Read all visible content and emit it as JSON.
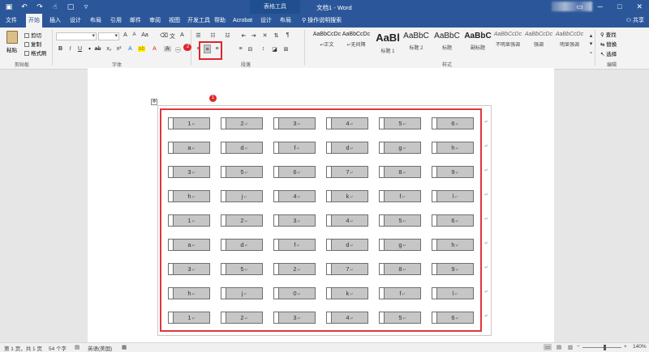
{
  "titlebar": {
    "context_tab": "表格工具",
    "doc_title": "文档1 - Word"
  },
  "tabs": [
    {
      "label": "文件",
      "active": false
    },
    {
      "label": "开始",
      "active": true
    },
    {
      "label": "插入",
      "active": false
    },
    {
      "label": "设计",
      "active": false
    },
    {
      "label": "布局",
      "active": false
    },
    {
      "label": "引用",
      "active": false
    },
    {
      "label": "邮件",
      "active": false
    },
    {
      "label": "审阅",
      "active": false
    },
    {
      "label": "视图",
      "active": false
    },
    {
      "label": "开发工具",
      "active": false
    },
    {
      "label": "帮助",
      "active": false
    },
    {
      "label": "Acrobat",
      "active": false
    },
    {
      "label": "设计",
      "active": false
    },
    {
      "label": "布局",
      "active": false
    }
  ],
  "tell_me": "操作说明搜索",
  "share": "共享",
  "clipboard": {
    "paste": "粘贴",
    "cut": "剪切",
    "copy": "复制",
    "format_painter": "格式刷",
    "group": "剪贴板"
  },
  "font": {
    "group": "字体"
  },
  "paragraph": {
    "group": "段落"
  },
  "badges": {
    "one": "1",
    "two": "2"
  },
  "styles": {
    "group": "样式",
    "items": [
      {
        "preview": "AaBbCcDc",
        "name": "↵正文"
      },
      {
        "preview": "AaBbCcDc",
        "name": "↵无间隔"
      },
      {
        "preview": "AaBl",
        "name": "标题 1"
      },
      {
        "preview": "AaBbC",
        "name": "标题 2"
      },
      {
        "preview": "AaBbC",
        "name": "标题"
      },
      {
        "preview": "AaBbC",
        "name": "副标题"
      },
      {
        "preview": "AaBbCcDc",
        "name": "不明显强调"
      },
      {
        "preview": "AaBbCcDc",
        "name": "强调"
      },
      {
        "preview": "AaBbCcDc",
        "name": "明显强调"
      }
    ]
  },
  "editing": {
    "find": "查找",
    "replace": "替换",
    "select": "选择",
    "group": "编辑"
  },
  "table": {
    "rows": [
      [
        "1",
        "2",
        "3",
        "4",
        "5",
        "6"
      ],
      [
        "a",
        "d",
        "f",
        "d",
        "g",
        "h"
      ],
      [
        "3",
        "5",
        "6",
        "7",
        "8",
        "9"
      ],
      [
        "h",
        "j",
        "4",
        "k",
        "f",
        "l"
      ],
      [
        "1",
        "2",
        "3",
        "4",
        "5",
        "6"
      ],
      [
        "a",
        "d",
        "f",
        "d",
        "g",
        "h"
      ],
      [
        "3",
        "5",
        "2",
        "7",
        "8",
        "9"
      ],
      [
        "h",
        "j",
        "0",
        "k",
        "f",
        "l"
      ],
      [
        "1",
        "2",
        "3",
        "4",
        "5",
        "6"
      ]
    ]
  },
  "status": {
    "page": "第 1 页，共 1 页",
    "words": "54 个字",
    "language": "英语(美国)",
    "zoom": "140%"
  }
}
